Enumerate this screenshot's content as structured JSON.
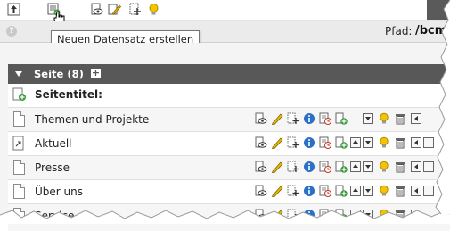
{
  "tooltip": {
    "text": "Neuen Datensatz erstellen"
  },
  "path": {
    "label": "Pfad:",
    "value": "/bcm"
  },
  "toolbar": {
    "icons": [
      "go-up-icon",
      "new-record-icon",
      "view-icon",
      "edit-page-icon",
      "new-page-icon",
      "lightbulb-icon"
    ]
  },
  "section": {
    "title": "Seite (8)",
    "add_symbol": "+"
  },
  "table": {
    "header_label": "Seitentitel:",
    "rows": [
      {
        "title": "Themen und Projekte"
      },
      {
        "title": "Aktuell"
      },
      {
        "title": "Presse"
      },
      {
        "title": "Über uns"
      },
      {
        "title": "Service"
      }
    ]
  },
  "colors": {
    "section_header": "#585858",
    "edit": "#e6b800",
    "info": "#2a6fc9",
    "add": "#3c9a3c",
    "history": "#c0392b"
  }
}
